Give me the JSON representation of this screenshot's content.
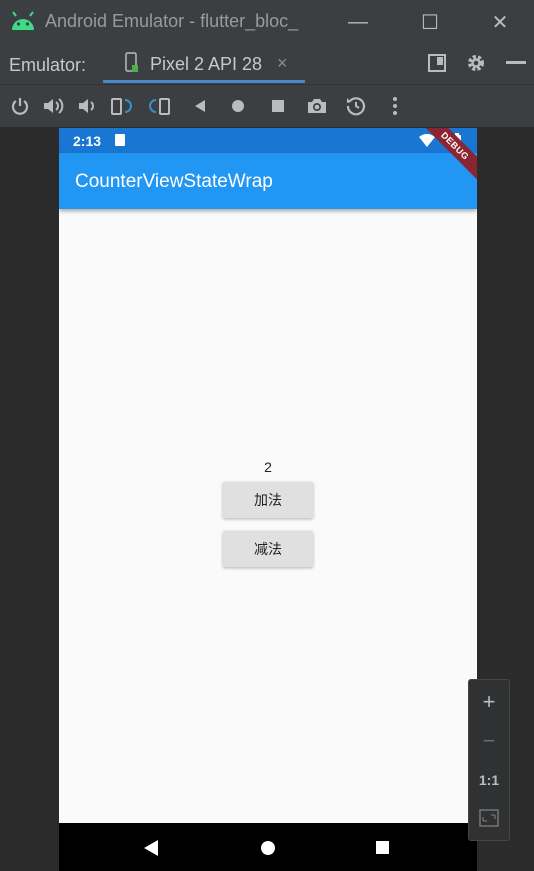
{
  "window": {
    "title": "Android Emulator - flutter_bloc_",
    "minimize_label": "—",
    "maximize_label": "☐",
    "close_label": "✕"
  },
  "tabbar": {
    "emulator_label": "Emulator:",
    "device_tab_label": "Pixel 2 API 28",
    "tab_close_label": "×",
    "accent_color": "#4a88c7"
  },
  "toolbar": {
    "tools": [
      "power-icon",
      "volume-up-icon",
      "volume-down-icon",
      "rotate-left-icon",
      "rotate-right-icon",
      "back-icon",
      "home-icon",
      "overview-icon",
      "screenshot-icon",
      "snapshot-icon",
      "more-icon"
    ]
  },
  "device": {
    "status_time": "2:13",
    "debug_label": "DEBUG",
    "app_title": "CounterViewStateWrap",
    "counter_value": "2",
    "add_button_label": "加法",
    "subtract_button_label": "减法",
    "appbar_color": "#2196f3",
    "statusbar_color": "#1976d2"
  },
  "zoom": {
    "zoom_in_label": "+",
    "zoom_out_label": "−",
    "one_to_one_label": "1:1"
  }
}
